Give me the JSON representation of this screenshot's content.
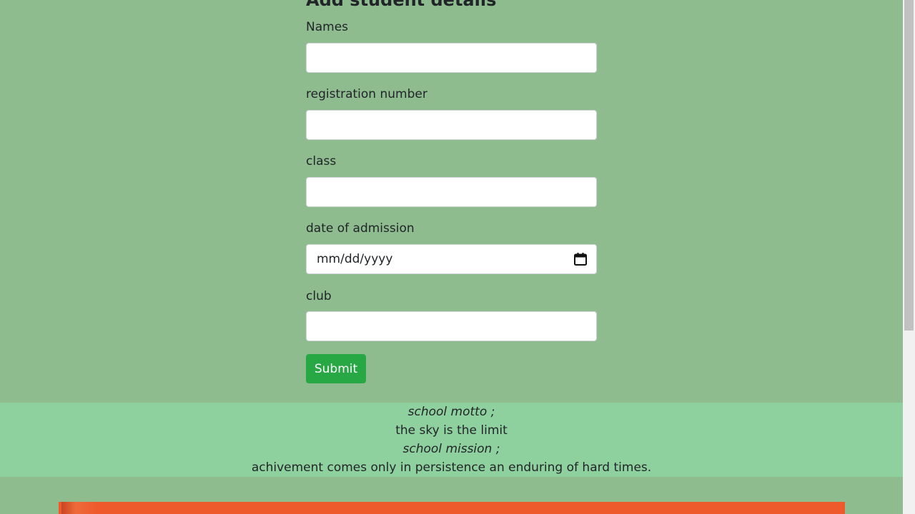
{
  "form": {
    "title": "Add student details",
    "fields": [
      {
        "label": "Names",
        "value": ""
      },
      {
        "label": "registration number",
        "value": ""
      },
      {
        "label": "class",
        "value": ""
      },
      {
        "label": "date of admission",
        "placeholder": "mm/dd/yyyy"
      },
      {
        "label": "club",
        "value": ""
      }
    ],
    "submit_label": "Submit"
  },
  "footer": {
    "motto_heading": "school motto ;",
    "motto": "the sky is the limit",
    "mission_heading": "school mission ;",
    "mission": "achivement comes only in persistence an enduring of hard times."
  },
  "colors": {
    "page_background": "#8fbc8f",
    "footer_background": "#8fd19e",
    "submit_button": "#28a745",
    "banner": "#ee5a2c"
  },
  "icons": {
    "date_picker": "calendar-icon"
  }
}
